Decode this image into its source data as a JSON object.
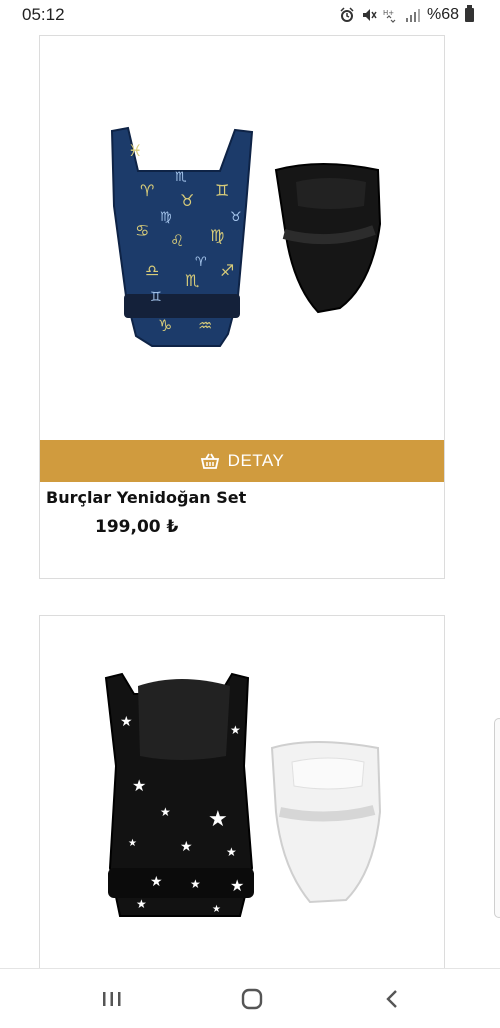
{
  "status_bar": {
    "time": "05:12",
    "battery_text": "%68",
    "icons": [
      "alarm-icon",
      "mute-icon",
      "wifi-icon",
      "signal-icon",
      "battery-icon"
    ]
  },
  "products": [
    {
      "title": "Burçlar Yenidoğan Set",
      "price": "199,00 ₺",
      "button_label": "DETAY",
      "image": "zodiac-pattern-baby-carrier-with-newborn-insert"
    },
    {
      "image": "star-pattern-baby-carrier-with-newborn-insert"
    }
  ],
  "nav_bar": {
    "icons": [
      "recent-apps-icon",
      "home-icon",
      "back-icon"
    ]
  },
  "colors": {
    "accent": "#d09b3e",
    "carrier_navy": "#1c3b6a",
    "carrier_black": "#121212"
  }
}
